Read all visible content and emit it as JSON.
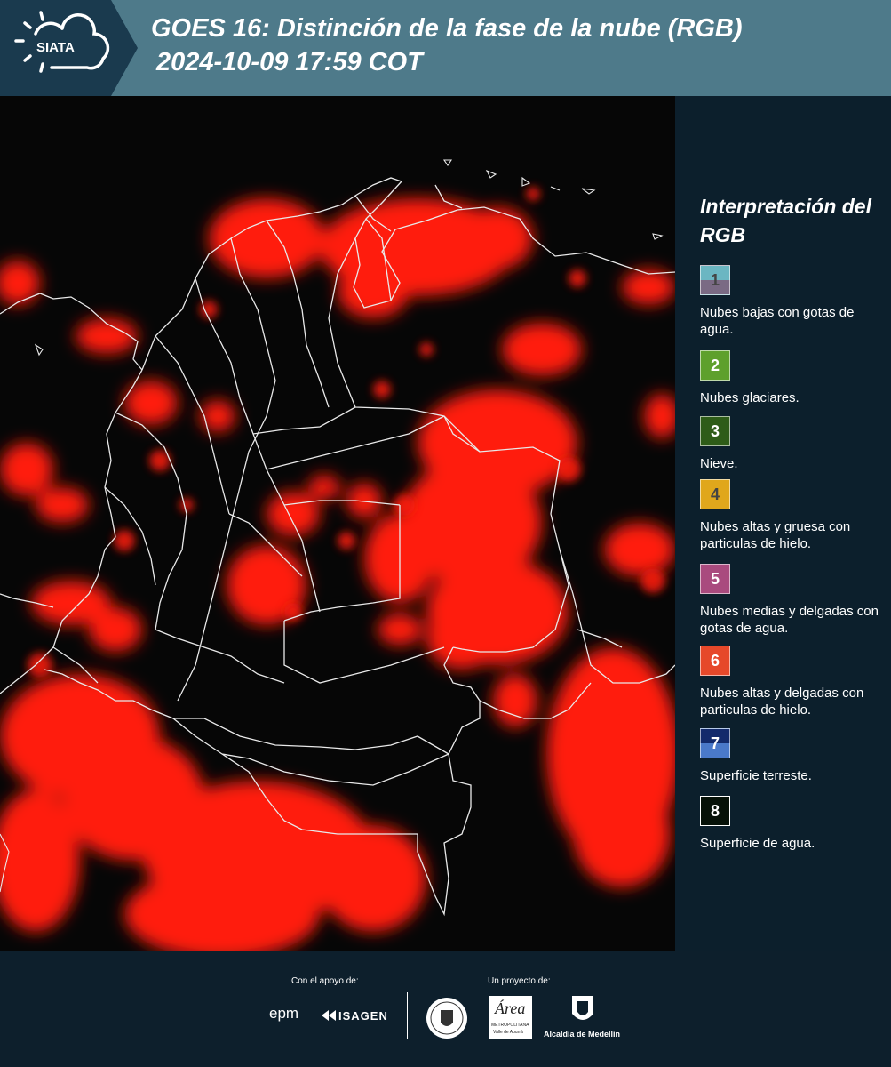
{
  "header": {
    "title_line1": "GOES 16: Distinción de la fase de la nube (RGB)",
    "title_line2": "2024-10-09 17:59 COT",
    "logo_text": "SIATA"
  },
  "legend": {
    "title": "Interpretación del RGB",
    "items": [
      {
        "number": "1",
        "label": "Nubes bajas con gotas de agua.",
        "colors": [
          "#6bb6c2",
          "#7a6a84"
        ],
        "num_color": "#444444"
      },
      {
        "number": "2",
        "label": "Nubes glaciares.",
        "colors": [
          "#5ea02c"
        ],
        "num_color": "#ffffff"
      },
      {
        "number": "3",
        "label": "Nieve.",
        "colors": [
          "#2e5c18"
        ],
        "num_color": "#ffffff"
      },
      {
        "number": "4",
        "label": "Nubes altas y gruesa con particulas de hielo.",
        "colors": [
          "#e0a71c"
        ],
        "num_color": "#444444"
      },
      {
        "number": "5",
        "label": "Nubes medias y delgadas con gotas de agua.",
        "colors": [
          "#a94a7e"
        ],
        "num_color": "#ffffff"
      },
      {
        "number": "6",
        "label": "Nubes altas y delgadas con particulas de hielo.",
        "colors": [
          "#e6482a"
        ],
        "num_color": "#ffffff"
      },
      {
        "number": "7",
        "label": "Superficie terreste.",
        "colors": [
          "#132a6b",
          "#4a79c9"
        ],
        "num_color": "#ffffff"
      },
      {
        "number": "8",
        "label": "Superficie de agua.",
        "colors": [
          "#061108"
        ],
        "num_color": "#ffffff"
      }
    ]
  },
  "footer": {
    "support_label": "Con el apoyo de:",
    "project_label": "Un proyecto de:",
    "sponsor1": "epm",
    "sponsor2": "ISAGEN",
    "partner_area": "Área",
    "partner_area_sub": "METROPOLITANA",
    "partner_area_sub2": "Valle de Aburrá",
    "partner_alcaldia": "Alcaldía de Medellín"
  },
  "colors": {
    "header_band": "#4e7a8a",
    "header_dark": "#163649",
    "cloud_red": "#ff1a10",
    "background": "#0d1f2c"
  }
}
